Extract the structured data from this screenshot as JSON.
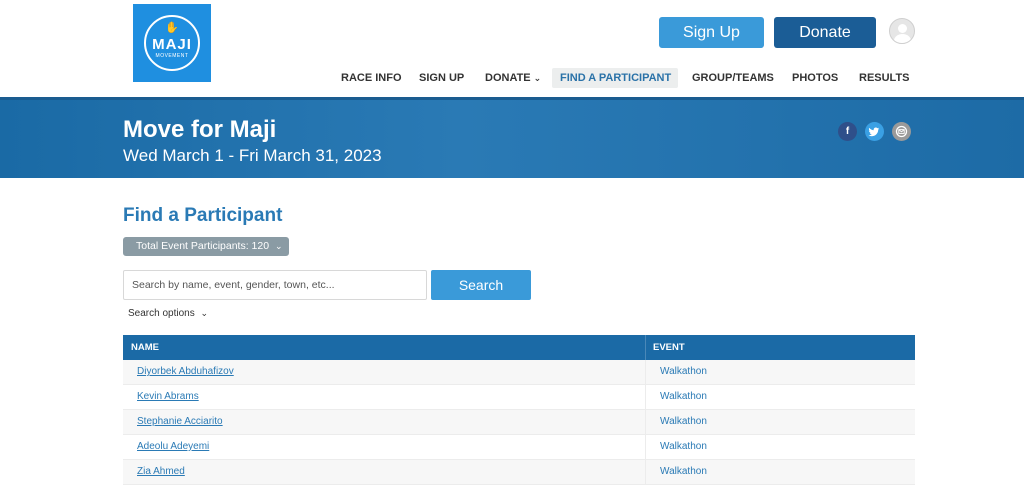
{
  "logo": {
    "main_text": "MAJI",
    "sub_text": "MOVEMENT",
    "icon": "hand-icon"
  },
  "header": {
    "signup_label": "Sign Up",
    "donate_label": "Donate"
  },
  "nav": {
    "items": [
      {
        "label": "RACE INFO"
      },
      {
        "label": "SIGN UP"
      },
      {
        "label": "DONATE",
        "has_dropdown": true
      },
      {
        "label": "FIND A PARTICIPANT",
        "active": true
      },
      {
        "label": "GROUP/TEAMS"
      },
      {
        "label": "PHOTOS"
      },
      {
        "label": "RESULTS"
      }
    ]
  },
  "banner": {
    "title": "Move for Maji",
    "dates": "Wed March 1 - Fri March 31, 2023",
    "social": [
      "facebook-icon",
      "twitter-icon",
      "email-icon"
    ]
  },
  "main": {
    "title": "Find a Participant",
    "participants_badge": "Total Event Participants: 120",
    "search_placeholder": "Search by name, event, gender, town, etc...",
    "search_button": "Search",
    "search_options": "Search options"
  },
  "table": {
    "headers": {
      "name": "NAME",
      "event": "EVENT"
    },
    "rows": [
      {
        "name": "Diyorbek Abduhafizov",
        "event": "Walkathon"
      },
      {
        "name": "Kevin Abrams",
        "event": "Walkathon"
      },
      {
        "name": "Stephanie Acciarito",
        "event": "Walkathon"
      },
      {
        "name": "Adeolu Adeyemi",
        "event": "Walkathon"
      },
      {
        "name": "Zia Ahmed",
        "event": "Walkathon"
      }
    ]
  },
  "colors": {
    "brand_blue": "#1f8fe0",
    "primary_button": "#3a9ad9",
    "donate_button": "#1b5d96",
    "table_header": "#1b6aa6",
    "link": "#2a7ab5"
  }
}
